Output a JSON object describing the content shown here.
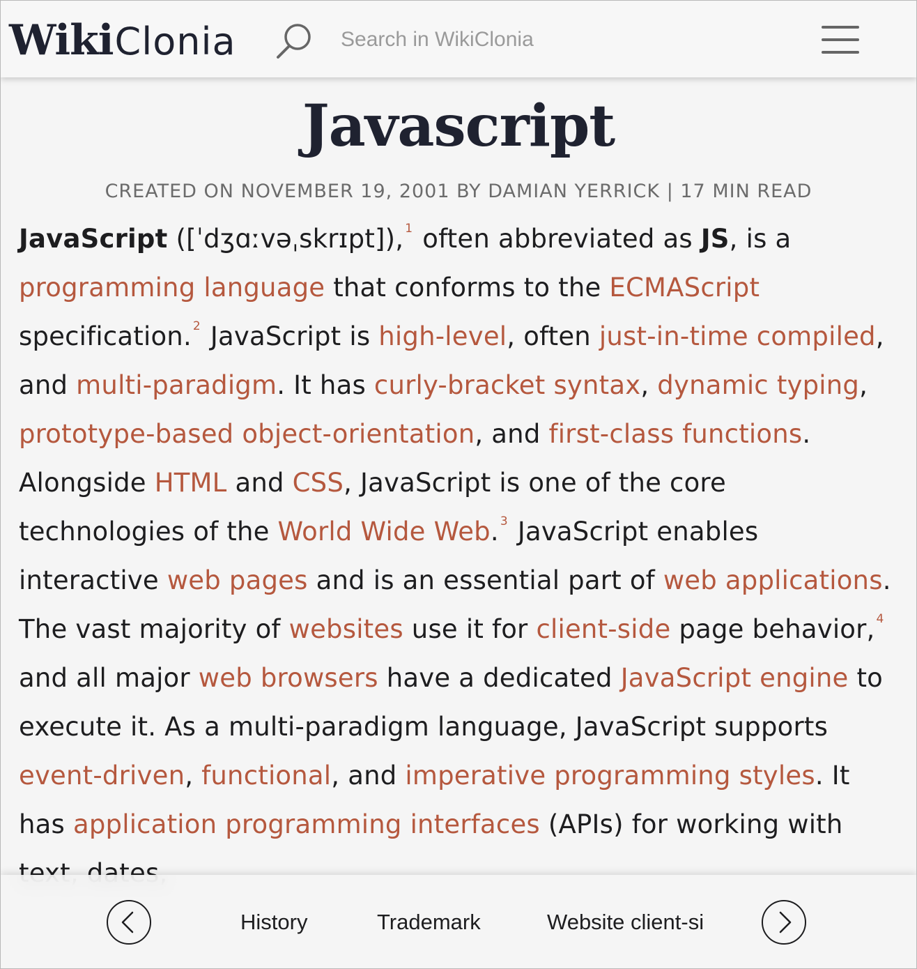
{
  "header": {
    "logo_bold": "Wiki",
    "logo_light": "Clonia",
    "search_placeholder": "Search in WikiClonia",
    "search_value": "",
    "icons": {
      "search": "search-icon",
      "menu": "hamburger-menu-icon"
    }
  },
  "article": {
    "title": "Javascript",
    "meta": "CREATED ON NOVEMBER 19, 2001 BY DAMIAN YERRICK | 17 MIN READ",
    "paragraph": [
      {
        "t": "b",
        "v": "JavaScript"
      },
      {
        "t": "text",
        "v": " (["
      },
      {
        "t": "text",
        "v": "ˈdʒɑːvəˌskrɪpt"
      },
      {
        "t": "text",
        "v": "]),"
      },
      {
        "t": "sup",
        "v": "1"
      },
      {
        "t": "text",
        "v": " often abbreviated as "
      },
      {
        "t": "b",
        "v": "JS"
      },
      {
        "t": "text",
        "v": ", is a "
      },
      {
        "t": "link",
        "v": "programming language"
      },
      {
        "t": "text",
        "v": " that conforms to the "
      },
      {
        "t": "link",
        "v": "ECMAScript"
      },
      {
        "t": "text",
        "v": " specification."
      },
      {
        "t": "sup",
        "v": "2"
      },
      {
        "t": "text",
        "v": " JavaScript is "
      },
      {
        "t": "link",
        "v": "high-level"
      },
      {
        "t": "text",
        "v": ", often "
      },
      {
        "t": "link",
        "v": "just-in-time compiled"
      },
      {
        "t": "text",
        "v": ", and "
      },
      {
        "t": "link",
        "v": "multi-paradigm"
      },
      {
        "t": "text",
        "v": ". It has "
      },
      {
        "t": "link",
        "v": "curly-bracket syntax"
      },
      {
        "t": "text",
        "v": ", "
      },
      {
        "t": "link",
        "v": "dynamic typing"
      },
      {
        "t": "text",
        "v": ", "
      },
      {
        "t": "link",
        "v": "prototype-based object-orientation"
      },
      {
        "t": "text",
        "v": ", and "
      },
      {
        "t": "link",
        "v": "first-class functions"
      },
      {
        "t": "text",
        "v": ". Alongside "
      },
      {
        "t": "link",
        "v": "HTML"
      },
      {
        "t": "text",
        "v": " and "
      },
      {
        "t": "link",
        "v": "CSS"
      },
      {
        "t": "text",
        "v": ", JavaScript is one of the core technologies of the "
      },
      {
        "t": "link",
        "v": "World Wide Web"
      },
      {
        "t": "text",
        "v": "."
      },
      {
        "t": "sup",
        "v": "3"
      },
      {
        "t": "text",
        "v": " JavaScript enables interactive "
      },
      {
        "t": "link",
        "v": "web pages"
      },
      {
        "t": "text",
        "v": " and is an essential part of "
      },
      {
        "t": "link",
        "v": "web applications"
      },
      {
        "t": "text",
        "v": ". The vast majority of "
      },
      {
        "t": "link",
        "v": "websites"
      },
      {
        "t": "text",
        "v": " use it for "
      },
      {
        "t": "link",
        "v": "client-side"
      },
      {
        "t": "text",
        "v": " page behavior,"
      },
      {
        "t": "sup",
        "v": "4"
      },
      {
        "t": "text",
        "v": " and all major "
      },
      {
        "t": "link",
        "v": "web browsers"
      },
      {
        "t": "text",
        "v": " have a dedicated "
      },
      {
        "t": "link",
        "v": "JavaScript engine"
      },
      {
        "t": "text",
        "v": " to execute it. As a multi-paradigm language, JavaScript supports "
      },
      {
        "t": "link",
        "v": "event-driven"
      },
      {
        "t": "text",
        "v": ", "
      },
      {
        "t": "link",
        "v": "functional"
      },
      {
        "t": "text",
        "v": ", and "
      },
      {
        "t": "link",
        "v": "imperative programming styles"
      },
      {
        "t": "text",
        "v": ". It has "
      },
      {
        "t": "link",
        "v": "application programming interfaces"
      },
      {
        "t": "text",
        "v": " (APIs) for working with text, dates,"
      }
    ]
  },
  "bottom_nav": {
    "prev_icon": "chevron-left-icon",
    "next_icon": "chevron-right-icon",
    "links": [
      "History",
      "Trademark",
      "Website client-si"
    ]
  },
  "colors": {
    "link": "#b5583e",
    "text": "#1d1d1f",
    "meta": "#6b6b6b",
    "background": "#f5f5f5"
  }
}
